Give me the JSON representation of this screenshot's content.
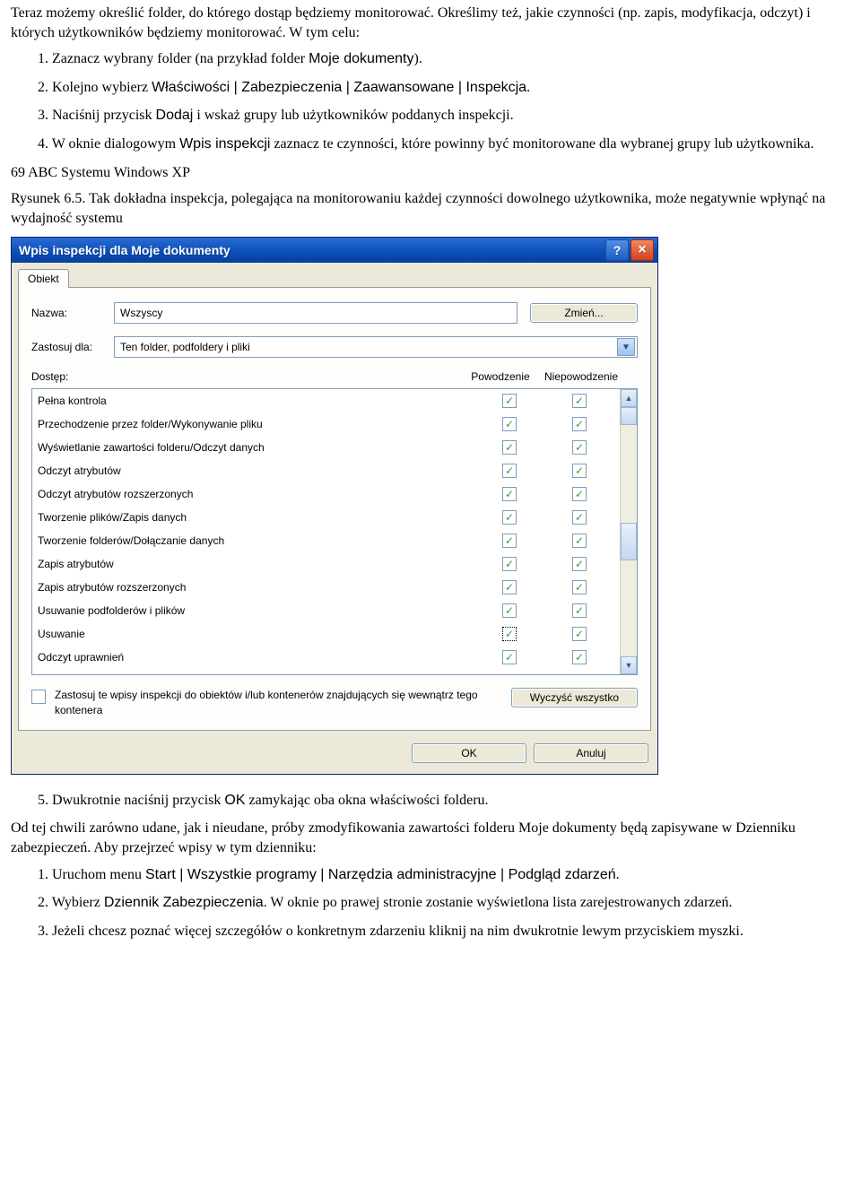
{
  "para_intro": "Teraz możemy określić folder, do którego dostąp będziemy monitorować. Określimy też, jakie czynności (np. zapis, modyfikacja, odczyt) i których użytkowników będziemy monitorować. W tym celu:",
  "steps_a": {
    "s1_a": "1. Zaznacz wybrany folder (na przykład folder ",
    "s1_b": "Moje dokumenty",
    "s1_c": ").",
    "s2_a": "2. Kolejno wybierz ",
    "s2_b": "Właściwości | Zabezpieczenia | Zaawansowane | Inspekcja",
    "s2_c": ".",
    "s3_a": "3. Naciśnij przycisk ",
    "s3_b": "Dodaj",
    "s3_c": " i wskaż grupy lub użytkowników poddanych inspekcji.",
    "s4_a": "4. W oknie dialogowym ",
    "s4_b": "Wpis inspekcji",
    "s4_c": " zaznacz te czynności, które powinny być monitorowane dla wybranej grupy lub użytkownika."
  },
  "mid_note": "69 ABC Systemu Windows XP",
  "fig_caption": "Rysunek 6.5. Tak dokładna inspekcja, polegająca na monitorowaniu każdej czynności dowolnego użytkownika, może negatywnie wpłynąć na wydajność systemu",
  "dialog": {
    "title": "Wpis inspekcji dla Moje dokumenty",
    "tab": "Obiekt",
    "name_label": "Nazwa:",
    "name_value": "Wszyscy",
    "change_btn": "Zmień...",
    "apply_label": "Zastosuj dla:",
    "apply_value": "Ten folder, podfoldery i pliki",
    "access_hdr": "Dostęp:",
    "col_success": "Powodzenie",
    "col_fail": "Niepowodzenie",
    "items": [
      {
        "name": "Pełna kontrola",
        "s": true,
        "f": true
      },
      {
        "name": "Przechodzenie przez folder/Wykonywanie pliku",
        "s": true,
        "f": true
      },
      {
        "name": "Wyświetlanie zawartości folderu/Odczyt danych",
        "s": true,
        "f": true
      },
      {
        "name": "Odczyt atrybutów",
        "s": true,
        "f": true
      },
      {
        "name": "Odczyt atrybutów rozszerzonych",
        "s": true,
        "f": true
      },
      {
        "name": "Tworzenie plików/Zapis danych",
        "s": true,
        "f": true
      },
      {
        "name": "Tworzenie folderów/Dołączanie danych",
        "s": true,
        "f": true
      },
      {
        "name": "Zapis atrybutów",
        "s": true,
        "f": true
      },
      {
        "name": "Zapis atrybutów rozszerzonych",
        "s": true,
        "f": true
      },
      {
        "name": "Usuwanie podfolderów i plików",
        "s": true,
        "f": true
      },
      {
        "name": "Usuwanie",
        "s": true,
        "f": true,
        "focused": true
      },
      {
        "name": "Odczyt uprawnień",
        "s": true,
        "f": true
      }
    ],
    "apply_nested": "Zastosuj te wpisy inspekcji do obiektów i/lub kontenerów znajdujących się wewnątrz tego kontenera",
    "clear_btn": "Wyczyść wszystko",
    "ok_btn": "OK",
    "cancel_btn": "Anuluj"
  },
  "step5_a": "5. Dwukrotnie naciśnij przycisk ",
  "step5_b": "OK",
  "step5_c": " zamykając oba okna właściwości folderu.",
  "para_after": "Od tej chwili zarówno udane, jak i nieudane, próby zmodyfikowania zawartości folderu Moje dokumenty będą zapisywane w Dzienniku zabezpieczeń. Aby przejrzeć wpisy w tym dzienniku:",
  "steps_b": {
    "b1_a": "1. Uruchom menu ",
    "b1_b": "Start | Wszystkie programy | Narzędzia administracyjne | Podgląd zdarzeń",
    "b1_c": ".",
    "b2_a": "2. Wybierz ",
    "b2_b": "Dziennik Zabezpieczenia",
    "b2_c": ". W oknie po prawej stronie zostanie wyświetlona lista zarejestrowanych zdarzeń.",
    "b3": "3. Jeżeli chcesz poznać więcej szczegółów o konkretnym zdarzeniu kliknij na nim dwukrotnie lewym przyciskiem myszki."
  }
}
